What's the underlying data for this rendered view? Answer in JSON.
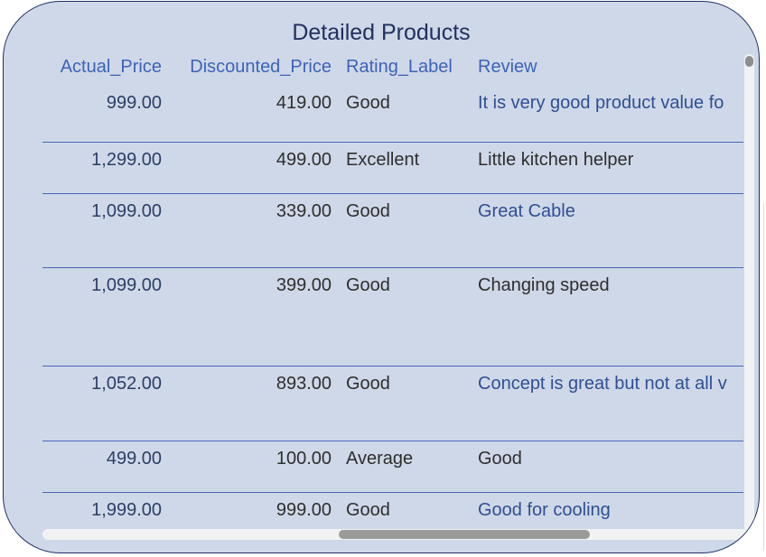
{
  "title": "Detailed Products",
  "columns": {
    "actual_price": "Actual_Price",
    "discounted_price": "Discounted_Price",
    "rating_label": "Rating_Label",
    "review": "Review"
  },
  "rows": [
    {
      "actual_price": "999.00",
      "discounted_price": "419.00",
      "rating_label": "Good",
      "review": "It is very good product value fo"
    },
    {
      "actual_price": "1,299.00",
      "discounted_price": "499.00",
      "rating_label": "Excellent",
      "review": "Little kitchen helper"
    },
    {
      "actual_price": "1,099.00",
      "discounted_price": "339.00",
      "rating_label": "Good",
      "review": "Great Cable"
    },
    {
      "actual_price": "1,099.00",
      "discounted_price": "399.00",
      "rating_label": "Good",
      "review": "Changing speed"
    },
    {
      "actual_price": "1,052.00",
      "discounted_price": "893.00",
      "rating_label": "Good",
      "review": "Concept is great but not at all v"
    },
    {
      "actual_price": "499.00",
      "discounted_price": "100.00",
      "rating_label": "Average",
      "review": "Good"
    },
    {
      "actual_price": "1,999.00",
      "discounted_price": "999.00",
      "rating_label": "Good",
      "review": "Good for cooling"
    }
  ],
  "colors": {
    "panel_background": "#cfd8e8",
    "panel_border": "#1f2f66",
    "header_text": "#3d63b8",
    "row_divider": "#4a66b8"
  }
}
